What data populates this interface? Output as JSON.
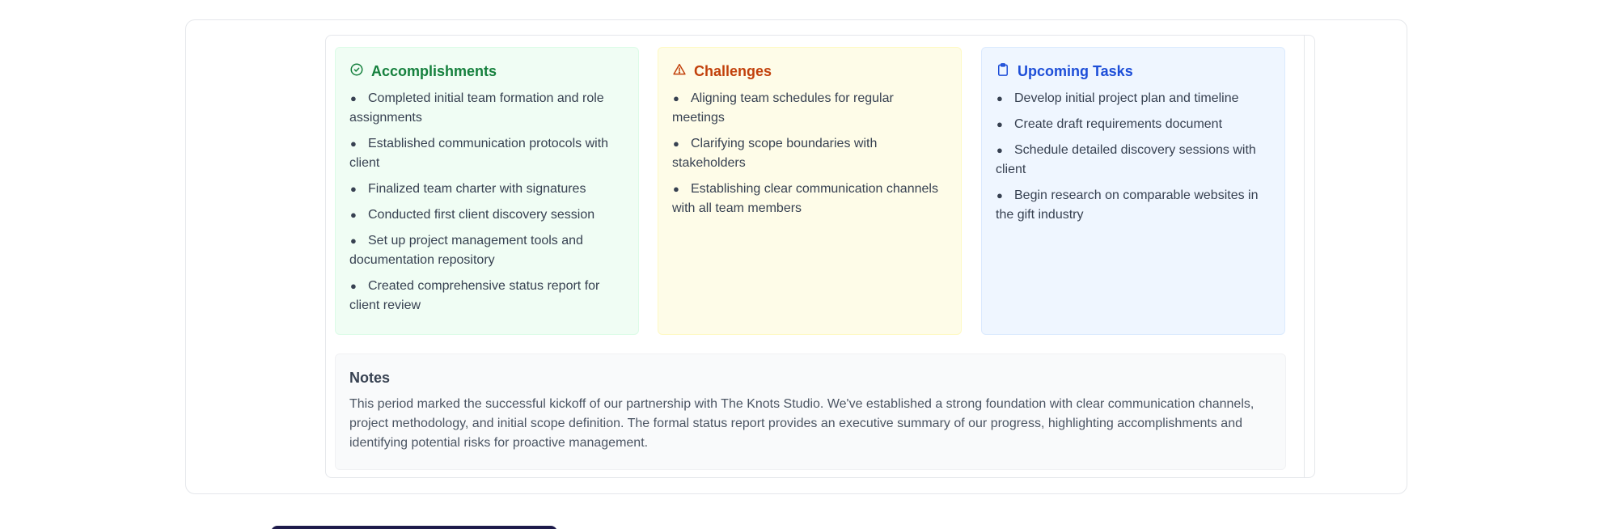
{
  "columns": {
    "accomplishments": {
      "title": "Accomplishments",
      "icon": "check-circle-icon",
      "color": "#15803d",
      "items": [
        "Completed initial team formation and role assignments",
        "Established communication protocols with client",
        "Finalized team charter with signatures",
        "Conducted first client discovery session",
        "Set up project management tools and documentation repository",
        "Created comprehensive status report for client review"
      ]
    },
    "challenges": {
      "title": "Challenges",
      "icon": "warning-triangle-icon",
      "color": "#c2410c",
      "items": [
        "Aligning team schedules for regular meetings",
        "Clarifying scope boundaries with stakeholders",
        "Establishing clear communication channels with all team members"
      ]
    },
    "upcoming": {
      "title": "Upcoming Tasks",
      "icon": "clipboard-icon",
      "color": "#1d4ed8",
      "items": [
        "Develop initial project plan and timeline",
        "Create draft requirements document",
        "Schedule detailed discovery sessions with client",
        "Begin research on comparable websites in the gift industry"
      ]
    }
  },
  "notes": {
    "title": "Notes",
    "body": "This period marked the successful kickoff of our partnership with The Knots Studio. We've established a strong foundation with clear communication channels, project methodology, and initial scope definition. The formal status report provides an executive summary of our progress, highlighting accomplishments and identifying potential risks for proactive management."
  }
}
